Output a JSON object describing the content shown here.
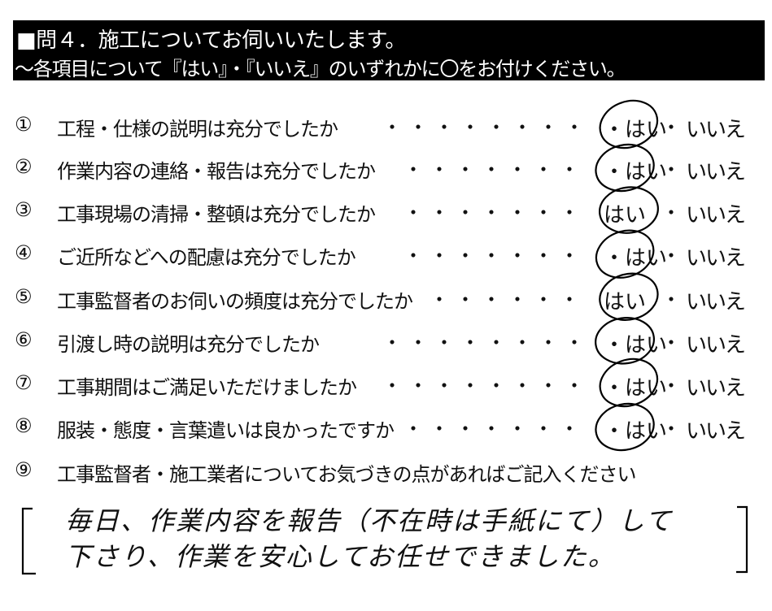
{
  "header": {
    "title": "■問４．施工についてお伺いいたします。",
    "instruction": "～各項目について『はい』・『いいえ』のいずれかに〇をお付けください。"
  },
  "questions": [
    {
      "number": "①",
      "text": "工程・仕様の説明は充分でしたか",
      "dots": "・・・・・・・・",
      "yes": "・はい",
      "sep": "・",
      "no": "いいえ",
      "answer": "はい"
    },
    {
      "number": "②",
      "text": "作業内容の連絡・報告は充分でしたか",
      "dots": "・・・・・・・",
      "yes": "・はい",
      "sep": "・",
      "no": "いいえ",
      "answer": "はい"
    },
    {
      "number": "③",
      "text": "工事現場の清掃・整頓は充分でしたか",
      "dots": "・・・・・・・",
      "yes": "はい",
      "sep": "・",
      "no": "いいえ",
      "answer": "はい"
    },
    {
      "number": "④",
      "text": "ご近所などへの配慮は充分でしたか",
      "dots": "・・・・・・・",
      "yes": "・はい",
      "sep": "・",
      "no": "いいえ",
      "answer": "はい"
    },
    {
      "number": "⑤",
      "text": "工事監督者のお伺いの頻度は充分でしたか",
      "dots": "・・・・・・",
      "yes": "はい",
      "sep": "・",
      "no": "いいえ",
      "answer": "はい"
    },
    {
      "number": "⑥",
      "text": "引渡し時の説明は充分でしたか",
      "dots": "・・・・・・・・",
      "yes": "・はい",
      "sep": "・",
      "no": "いいえ",
      "answer": "はい"
    },
    {
      "number": "⑦",
      "text": "工事期間はご満足いただけましたか",
      "dots": "・・・・・・・・",
      "yes": "・はい",
      "sep": "・",
      "no": "いいえ",
      "answer": "はい"
    },
    {
      "number": "⑧",
      "text": "服装・態度・言葉遣いは良かったですか",
      "dots": "・・・・・・・",
      "yes": "・はい",
      "sep": "・",
      "no": "いいえ",
      "answer": "はい"
    }
  ],
  "free_comment": {
    "number": "⑨",
    "prompt": "工事監督者・施工業者についてお気づきの点があればご記入ください",
    "answer_line1": "毎日、作業内容を報告（不在時は手紙にて）して",
    "answer_line2": "下さり、作業を安心してお任せできました。"
  }
}
